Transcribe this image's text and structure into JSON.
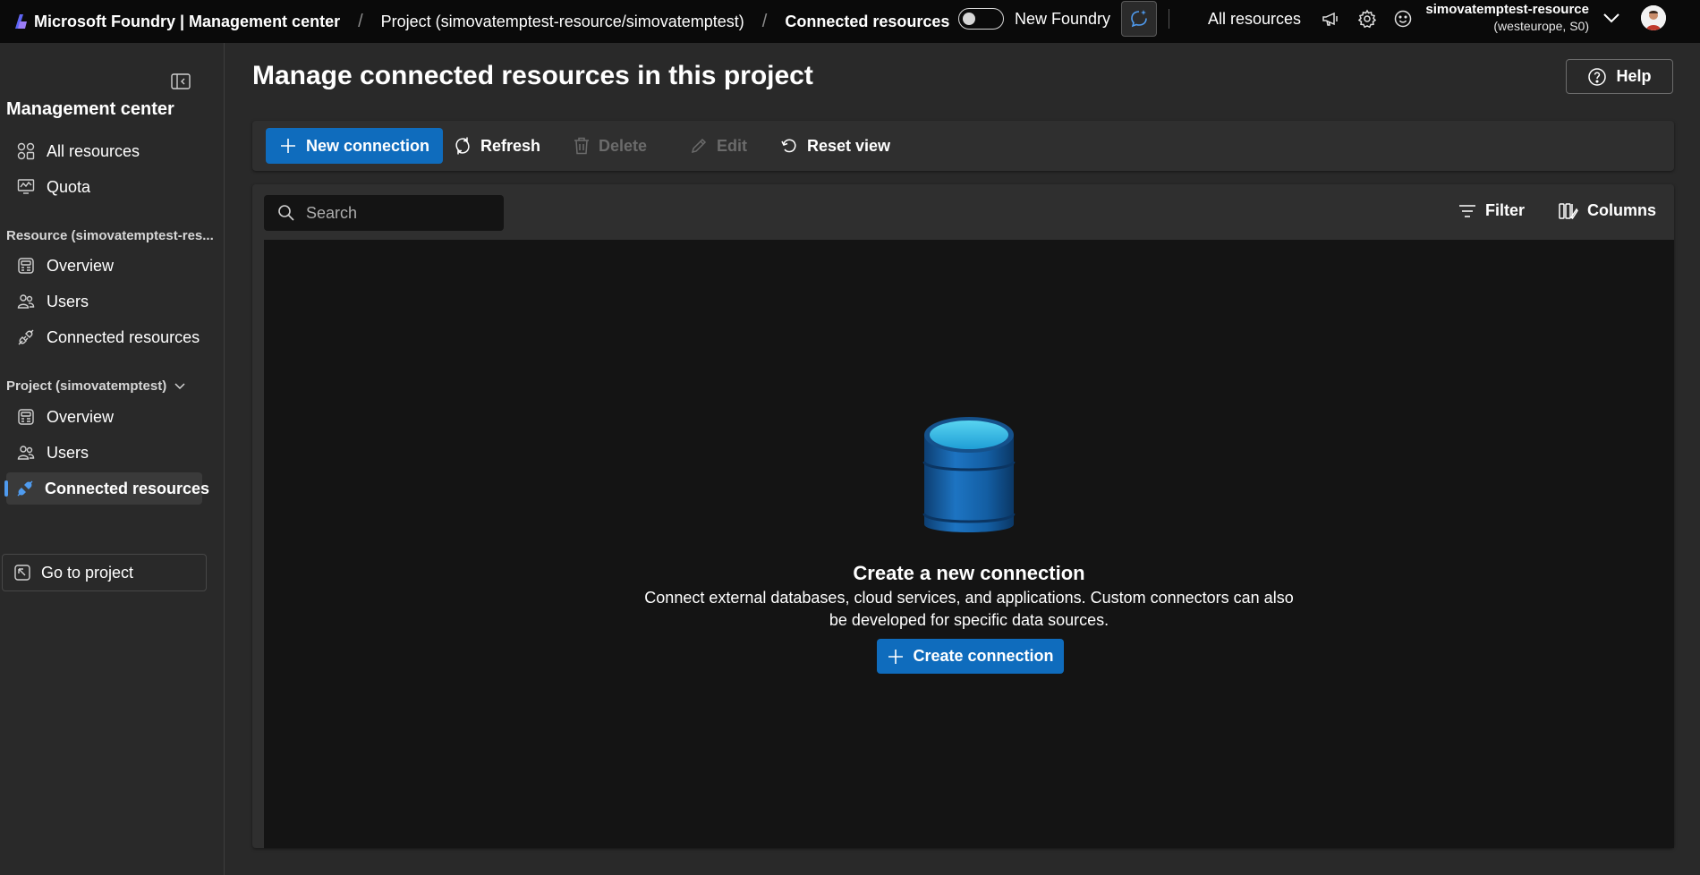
{
  "topbar": {
    "brand": "Microsoft Foundry | Management center",
    "breadcrumb": [
      "Project (simovatemptest-resource/simovatemptest)",
      "Connected resources"
    ],
    "toggle_label": "New Foundry",
    "all_resources": "All resources",
    "account_name": "simovatemptest-resource",
    "account_sub": "(westeurope, S0)"
  },
  "sidebar": {
    "title": "Management center",
    "top_items": [
      {
        "label": "All resources",
        "icon": "grid-icon"
      },
      {
        "label": "Quota",
        "icon": "chart-icon"
      }
    ],
    "resource_section": "Resource (simovatemptest-res...",
    "resource_items": [
      {
        "label": "Overview",
        "icon": "overview-icon"
      },
      {
        "label": "Users",
        "icon": "users-icon"
      },
      {
        "label": "Connected resources",
        "icon": "plug-icon"
      }
    ],
    "project_section": "Project (simovatemptest)",
    "project_items": [
      {
        "label": "Overview",
        "icon": "overview-icon"
      },
      {
        "label": "Users",
        "icon": "users-icon"
      },
      {
        "label": "Connected resources",
        "icon": "plug-icon",
        "active": true
      }
    ],
    "goto_project": "Go to project"
  },
  "main": {
    "title": "Manage connected resources in this project",
    "help": "Help",
    "toolbar": {
      "new_connection": "New connection",
      "refresh": "Refresh",
      "delete": "Delete",
      "edit": "Edit",
      "reset_view": "Reset view"
    },
    "search": {
      "placeholder": "Search",
      "value": ""
    },
    "filter": "Filter",
    "columns": "Columns",
    "empty_state": {
      "title": "Create a new connection",
      "description": "Connect external databases, cloud services, and applications. Custom connectors can also be developed for specific data sources.",
      "button": "Create connection"
    }
  },
  "colors": {
    "accent": "#0f6cbd",
    "active_indicator": "#4f9bef",
    "background": "#292929",
    "grid_background": "#141414",
    "topbar": "#0a0a0a"
  }
}
